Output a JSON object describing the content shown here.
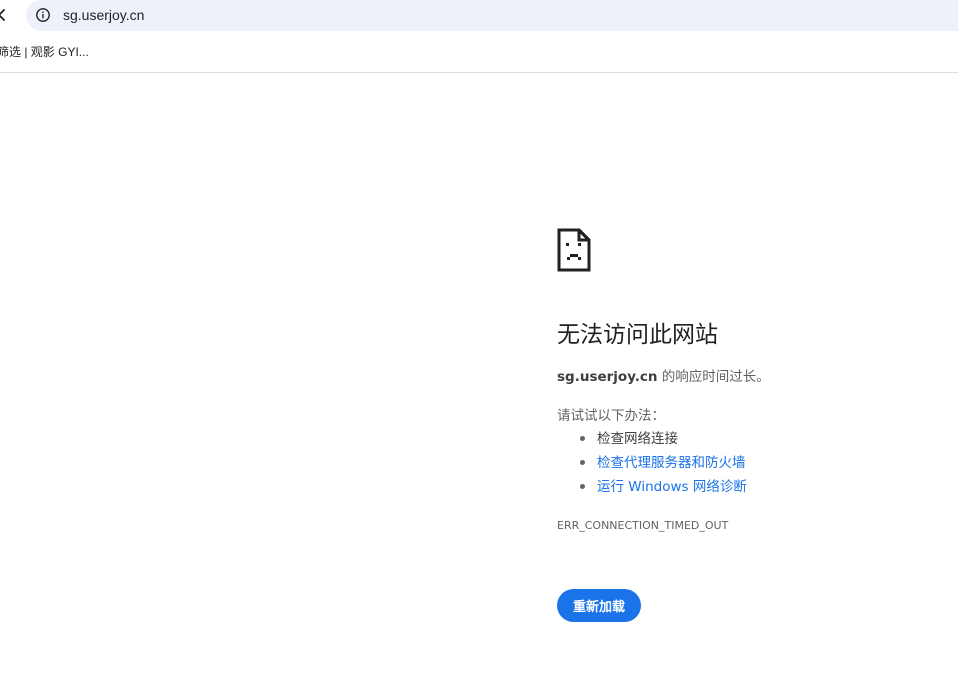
{
  "browser": {
    "url": "sg.userjoy.cn",
    "icons": {
      "back": "back-arrow-icon",
      "site_info": "info-icon"
    }
  },
  "bookmarks": [
    {
      "label": "筛选 | 观影 GYI..."
    }
  ],
  "error_page": {
    "icon": "sad-document-icon",
    "title": "无法访问此网站",
    "host": "sg.userjoy.cn",
    "description_suffix": " 的响应时间过长。",
    "try_label": "请试试以下办法：",
    "suggestions": [
      {
        "label": "检查网络连接",
        "is_link": false
      },
      {
        "label": "检查代理服务器和防火墙",
        "is_link": true
      },
      {
        "label": "运行 Windows 网络诊断",
        "is_link": true
      }
    ],
    "error_code": "ERR_CONNECTION_TIMED_OUT",
    "reload_label": "重新加载"
  },
  "colors": {
    "omnibox_bg": "#eef1f9",
    "link": "#1a73e8",
    "button_bg": "#1a73e8",
    "text_primary": "#202124",
    "text_secondary": "#5f6368"
  }
}
